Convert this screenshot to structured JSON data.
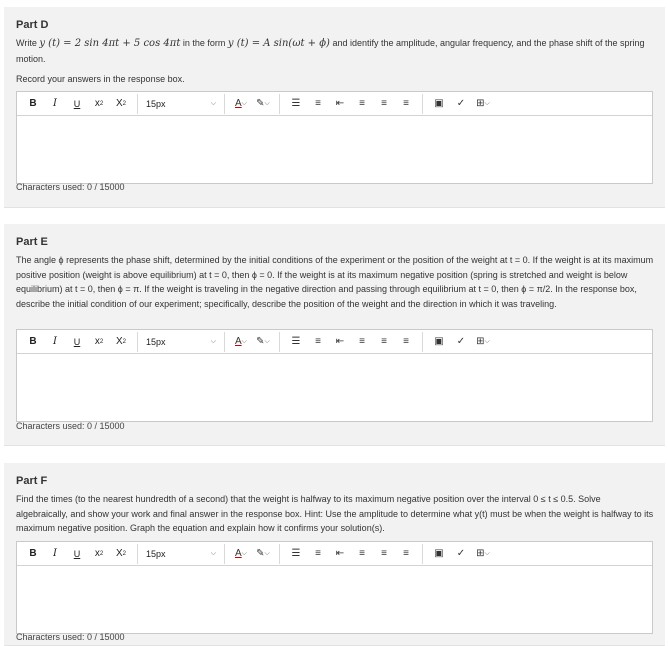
{
  "parts": [
    {
      "title": "Part D",
      "prompt_pre": "Write ",
      "prompt_expr": "y (t) = 2 sin 4πt + 5 cos 4πt",
      "prompt_mid": " in the form ",
      "prompt_form": "y (t) = A sin(ωt + ϕ)",
      "prompt_post": " and identify the amplitude, angular frequency, and the phase shift of the spring motion.",
      "instruction": "Record your answers in the response box.",
      "chars_used": "Characters used: 0 / 15000"
    },
    {
      "title": "Part E",
      "prompt_text": "The angle ϕ represents the phase shift, determined by the initial conditions of the experiment or the position of the weight at t = 0. If the weight is at its maximum positive position (weight is above equilibrium) at t = 0, then ϕ = 0. If the weight is at its maximum negative position (spring is stretched and weight is below equilibrium) at t = 0, then ϕ = π. If the weight is traveling in the negative direction and passing through equilibrium at t = 0, then ϕ = π/2. In the response box, describe the initial condition of our experiment; specifically, describe the position of the weight and the direction in which it was traveling.",
      "chars_used": "Characters used: 0 / 15000"
    },
    {
      "title": "Part F",
      "prompt_text": "Find the times (to the nearest hundredth of a second) that the weight is halfway to its maximum negative position over the interval 0 ≤ t ≤ 0.5. Solve algebraically, and show your work and final answer in the response box. Hint: Use the amplitude to determine what y(t) must be when the weight is halfway to its maximum negative position. Graph the equation and explain how it confirms your solution(s).",
      "chars_used": "Characters used: 0 / 15000"
    }
  ],
  "toolbar": {
    "bold": "B",
    "italic": "I",
    "underline": "U",
    "superscript_base": "x",
    "superscript_mark": "2",
    "subscript_base": "X",
    "subscript_mark": "2",
    "font_size": "15px",
    "icons": [
      "text-color-icon",
      "highlight-icon",
      "bullet-list-icon",
      "numbered-list-icon",
      "outdent-icon",
      "align-left-icon",
      "align-center-icon",
      "align-right-icon",
      "image-icon",
      "spellcheck-icon",
      "table-icon"
    ]
  }
}
